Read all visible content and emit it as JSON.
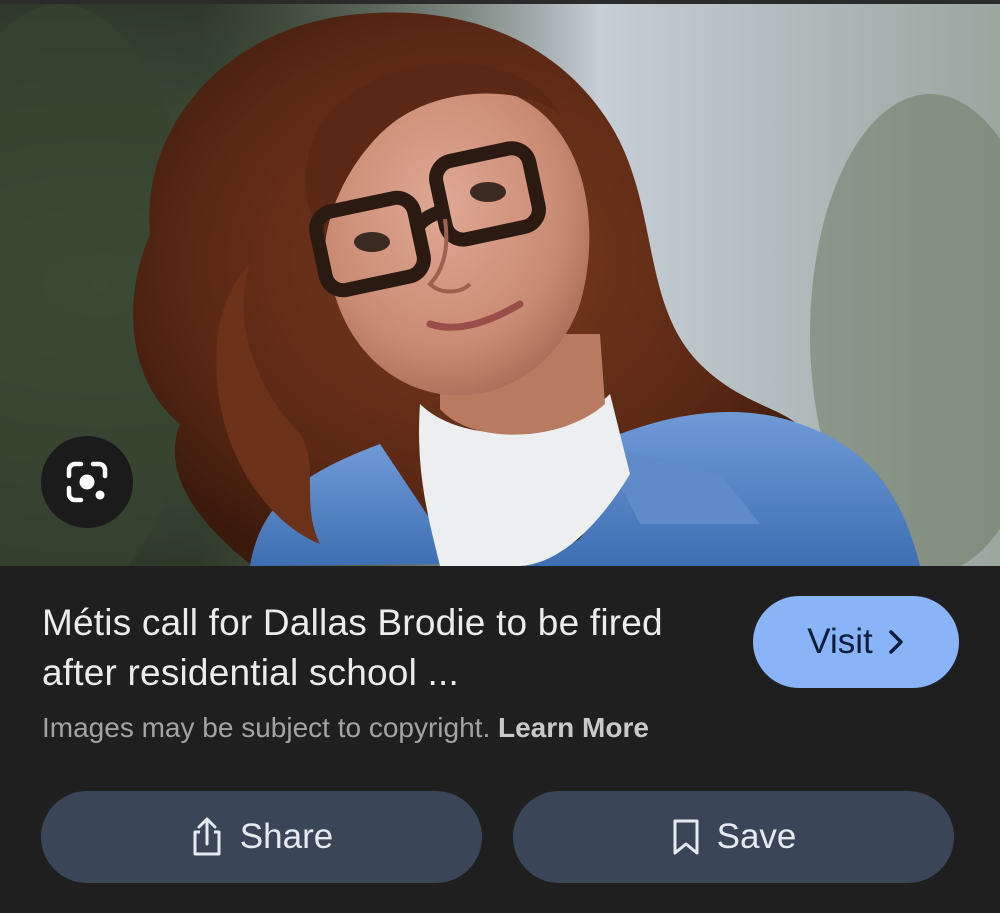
{
  "result": {
    "title": "Métis call for Dallas Brodie to be fired after residential school ...",
    "visit_label": "Visit",
    "copyright_text": "Images may be subject to copyright.",
    "learn_more_label": "Learn More"
  },
  "actions": {
    "share_label": "Share",
    "save_label": "Save"
  },
  "icons": {
    "lens": "google-lens-icon",
    "visit_chevron": "chevron-right-icon",
    "share": "share-icon",
    "save": "bookmark-icon"
  },
  "colors": {
    "background": "#1f1f1f",
    "visit_button": "#8ab4f8",
    "action_button": "#3a4558",
    "title_text": "#ececec",
    "secondary_text": "#a3a3a3"
  }
}
